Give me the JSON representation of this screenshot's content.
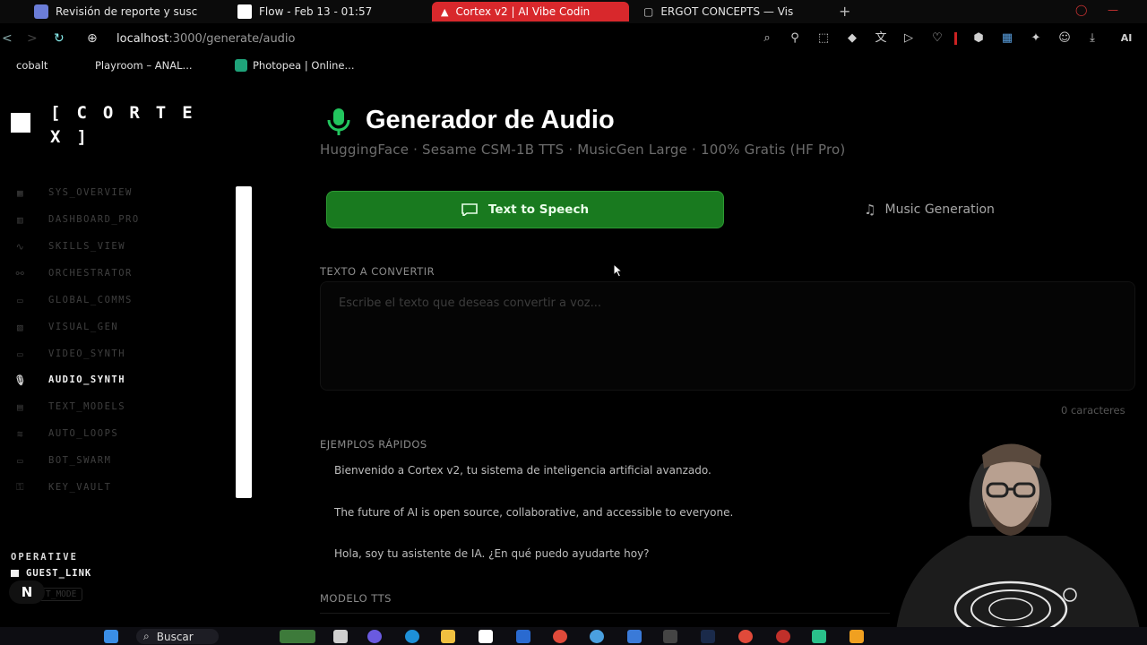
{
  "browser": {
    "tabs": [
      {
        "title": "Revisión de reporte y susc",
        "icon_color": "#6b7dd8",
        "active": false
      },
      {
        "title": "Flow - Feb 13 - 01:57",
        "icon_color": "#ffffff",
        "active": false
      },
      {
        "title": "Cortex v2 | AI Vibe Codin",
        "icon_color": "#ffffff",
        "active": true
      },
      {
        "title": "ERGOT CONCEPTS — Vis",
        "icon_color": "#cfcfcf",
        "active": false
      }
    ],
    "new_tab_label": "+",
    "url_host": "localhost",
    "url_path": ":3000/generate/audio",
    "bookmarks": [
      {
        "label": "cobalt",
        "icon_color": "#000000"
      },
      {
        "label": "Playroom – ANAL...",
        "icon_color": "#000000"
      },
      {
        "label": "Photopea | Online...",
        "icon_color": "#1fa37a"
      }
    ],
    "ai_label": "AI"
  },
  "sidebar": {
    "logo_text": "[CORTEX]",
    "items": [
      {
        "label": "SYS_OVERVIEW",
        "icon": "grid-icon",
        "active": false
      },
      {
        "label": "DASHBOARD_PRO",
        "icon": "dashboard-icon",
        "active": false
      },
      {
        "label": "SKILLS_VIEW",
        "icon": "pulse-icon",
        "active": false
      },
      {
        "label": "ORCHESTRATOR",
        "icon": "nodes-icon",
        "active": false
      },
      {
        "label": "GLOBAL_COMMS",
        "icon": "chat-icon",
        "active": false
      },
      {
        "label": "VISUAL_GEN",
        "icon": "image-icon",
        "active": false
      },
      {
        "label": "VIDEO_SYNTH",
        "icon": "video-icon",
        "active": false
      },
      {
        "label": "AUDIO_SYNTH",
        "icon": "mic-icon",
        "active": true
      },
      {
        "label": "TEXT_MODELS",
        "icon": "text-icon",
        "active": false
      },
      {
        "label": "AUTO_LOOPS",
        "icon": "layers-icon",
        "active": false
      },
      {
        "label": "BOT_SWARM",
        "icon": "bot-icon",
        "active": false
      },
      {
        "label": "KEY_VAULT",
        "icon": "key-icon",
        "active": false
      }
    ],
    "status_label": "OPERATIVE",
    "user_label": "GUEST_LINK",
    "mode_label": "T_MODE",
    "badge_label": "N"
  },
  "main": {
    "title": "Generador de Audio",
    "subtitle": "HuggingFace · Sesame CSM-1B TTS · MusicGen Large · 100% Gratis (HF Pro)",
    "tabs": {
      "tts_label": "Text to Speech",
      "music_label": "Music Generation"
    },
    "text_label": "TEXTO A CONVERTIR",
    "text_placeholder": "Escribe el texto que deseas convertir a voz...",
    "char_count": "0 caracteres",
    "examples_label": "EJEMPLOS RÁPIDOS",
    "examples": [
      "Bienvenido a Cortex v2, tu sistema de inteligencia artificial avanzado.",
      "The future of AI is open source, collaborative, and accessible to everyone.",
      "Hola, soy tu asistente de IA. ¿En qué puedo ayudarte hoy?"
    ],
    "model_label": "MODELO TTS",
    "accent_color": "#197a1f"
  },
  "taskbar": {
    "search_label": "Buscar"
  }
}
